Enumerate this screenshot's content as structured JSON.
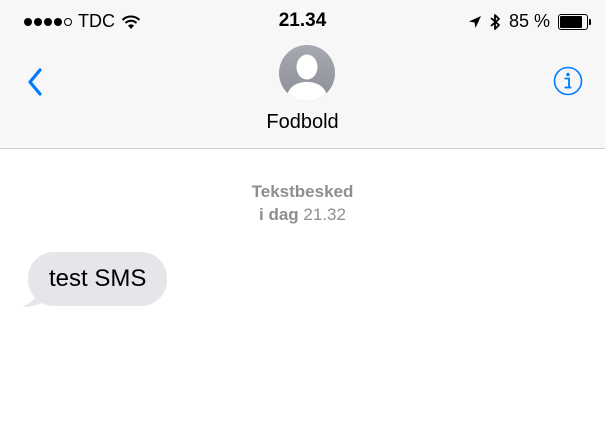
{
  "status_bar": {
    "carrier": "TDC",
    "signal_filled": 4,
    "signal_total": 5,
    "time": "21.34",
    "battery_text": "85 %",
    "battery_level": 0.85
  },
  "header": {
    "contact_name": "Fodbold"
  },
  "conversation": {
    "timestamp_label": "Tekstbesked",
    "timestamp_day": "i dag",
    "timestamp_time": "21.32",
    "messages": [
      {
        "direction": "incoming",
        "text": "test SMS"
      }
    ]
  },
  "colors": {
    "accent": "#007aff",
    "bubble_incoming": "#e5e5ea",
    "secondary_text": "#8e8e93",
    "bar_background": "#f7f7f7"
  },
  "icons": {
    "back": "chevron-left-icon",
    "info": "info-circle-icon",
    "avatar": "person-silhouette-icon",
    "wifi": "wifi-icon",
    "location": "location-arrow-icon",
    "bluetooth": "bluetooth-icon",
    "battery": "battery-icon"
  }
}
